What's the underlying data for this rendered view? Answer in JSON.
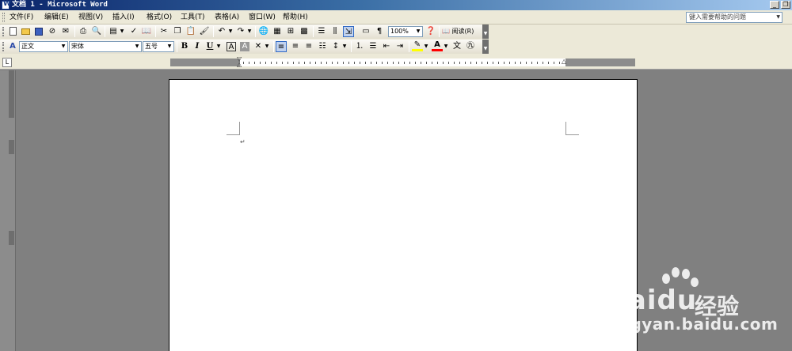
{
  "window": {
    "title": "文档 1 - Microsoft Word"
  },
  "menubar": {
    "items": [
      "文件(F)",
      "编辑(E)",
      "视图(V)",
      "插入(I)",
      "格式(O)",
      "工具(T)",
      "表格(A)",
      "窗口(W)",
      "帮助(H)"
    ],
    "help_placeholder": "键入需要帮助的问题"
  },
  "standard_toolbar": {
    "zoom": "100%",
    "read_label": "阅读(R)"
  },
  "formatting_toolbar": {
    "style": "正文",
    "font": "宋体",
    "size": "五号",
    "bold": "B",
    "italic": "I",
    "underline": "U"
  },
  "document": {
    "paragraph_mark": "↵"
  },
  "watermark": {
    "brand": "Baidu",
    "brand_cn": "经验",
    "url": "jingyan.baidu.com"
  },
  "colors": {
    "title_gradient_start": "#0a246a",
    "toolbar_bg": "#ece9d8",
    "workspace_bg": "#808080",
    "page_bg": "#ffffff",
    "font_color_bar": "#ff0000",
    "highlight_bar": "#ffff00"
  }
}
